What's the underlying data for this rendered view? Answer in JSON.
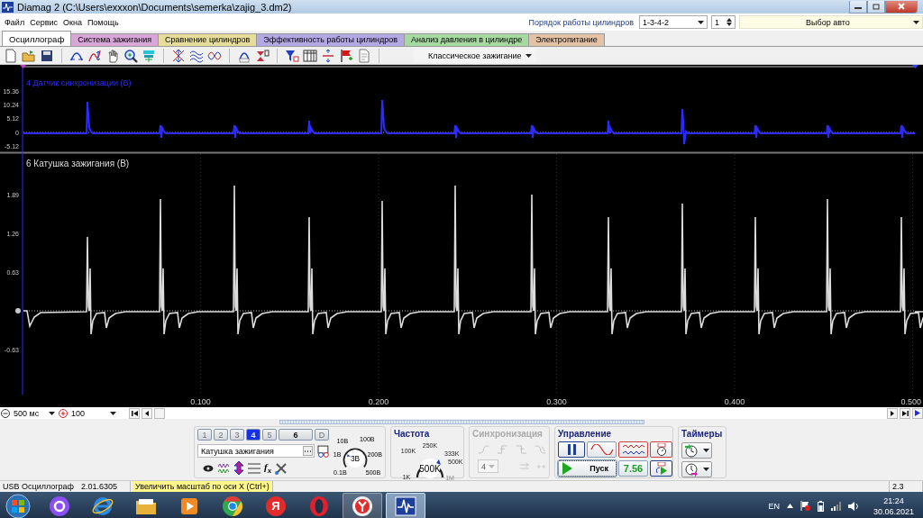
{
  "window": {
    "title": "Diamag 2 (C:\\Users\\exxxon\\Documents\\semerka\\zajig_3.dm2)"
  },
  "menu": [
    "Файл",
    "Сервис",
    "Окна",
    "Помощь"
  ],
  "cylinder_order": {
    "label": "Порядок работы цилиндров",
    "value": "1-3-4-2",
    "spinner": "1"
  },
  "car_select": {
    "value": "Выбор авто"
  },
  "tabs": [
    {
      "label": "Осциллограф",
      "selected": true,
      "color": "#ffffff"
    },
    {
      "label": "Система зажигания",
      "selected": false,
      "color": "#d9a6d9"
    },
    {
      "label": "Сравнение цилиндров",
      "selected": false,
      "color": "#e6dd9a"
    },
    {
      "label": "Эффективность работы цилиндров",
      "selected": false,
      "color": "#b3a8e3"
    },
    {
      "label": "Анализ давления в цилиндре",
      "selected": false,
      "color": "#a6d9a0"
    },
    {
      "label": "Электропитание",
      "selected": false,
      "color": "#e3c2a6"
    }
  ],
  "toolbar": {
    "mode": "Классическое зажигание"
  },
  "scope": {
    "channels": [
      {
        "title": "4 Датчик синхронизации (В)",
        "color": "#2b2bff",
        "ticks_above": [
          "15.36",
          "10.24",
          "5.12"
        ],
        "zero_label": "0",
        "ticks_below": [
          "-5.12"
        ]
      },
      {
        "title": "6 Катушка зажигания (В)",
        "color": "#dcdcdc",
        "ticks_above": [
          "1.89",
          "1.26",
          "0.63"
        ],
        "ticks_below": [
          "-0.63"
        ]
      }
    ],
    "xticks": [
      "0.100",
      "0.200",
      "0.300",
      "0.400",
      "0.500"
    ]
  },
  "timebase": {
    "time_scale": "500 мс",
    "zoom": "100"
  },
  "channel_panel": {
    "buttons": [
      {
        "label": "1",
        "selected": false,
        "disabled": true
      },
      {
        "label": "2",
        "selected": false,
        "disabled": true
      },
      {
        "label": "3",
        "selected": false,
        "disabled": true
      },
      {
        "label": "4",
        "selected": true,
        "disabled": false
      },
      {
        "label": "5",
        "selected": false,
        "disabled": true
      },
      {
        "label": "6",
        "selected": false,
        "disabled": false
      },
      {
        "label": "D",
        "selected": false,
        "disabled": true
      }
    ],
    "channel_name": "Катушка зажигания",
    "fx": "f$_{x}$",
    "range_dial": {
      "value": "3В",
      "labels": [
        "10В",
        "100В",
        "1В",
        "200В",
        "0.1В",
        "500В"
      ]
    }
  },
  "frequency": {
    "title": "Частота",
    "value": "500K",
    "labels": [
      {
        "label": "250K",
        "disabled": false
      },
      {
        "label": "100K",
        "disabled": false
      },
      {
        "label": "333K",
        "disabled": false
      },
      {
        "label": "500K",
        "disabled": false
      },
      {
        "label": "1K",
        "disabled": false
      },
      {
        "label": "1M",
        "disabled": true
      }
    ]
  },
  "sync": {
    "title": "Синхронизация",
    "disabled": true,
    "channel": "4"
  },
  "control": {
    "title": "Управление",
    "start": "Пуск",
    "reading": "7.56"
  },
  "timers": {
    "title": "Таймеры"
  },
  "status_bar": {
    "device": "USB Осциллограф",
    "version": "2.01.6305",
    "hint": "Увеличить масштаб по оси X (Ctrl+)",
    "value": "2.3"
  },
  "taskbar": {
    "apps": [
      {
        "kind": "assistant",
        "running": false,
        "selected": false
      },
      {
        "kind": "ie",
        "running": false,
        "selected": false
      },
      {
        "kind": "explorer",
        "running": false,
        "selected": false
      },
      {
        "kind": "media",
        "running": false,
        "selected": false
      },
      {
        "kind": "chrome",
        "running": false,
        "selected": false
      },
      {
        "kind": "yandex",
        "label": "Я",
        "running": false,
        "selected": false
      },
      {
        "kind": "opera",
        "running": false,
        "selected": false
      },
      {
        "kind": "ybrowser",
        "running": true,
        "selected": false
      },
      {
        "kind": "diamag",
        "running": true,
        "selected": true
      }
    ],
    "language": "EN",
    "time": "21:24",
    "date": "30.06.2021"
  }
}
